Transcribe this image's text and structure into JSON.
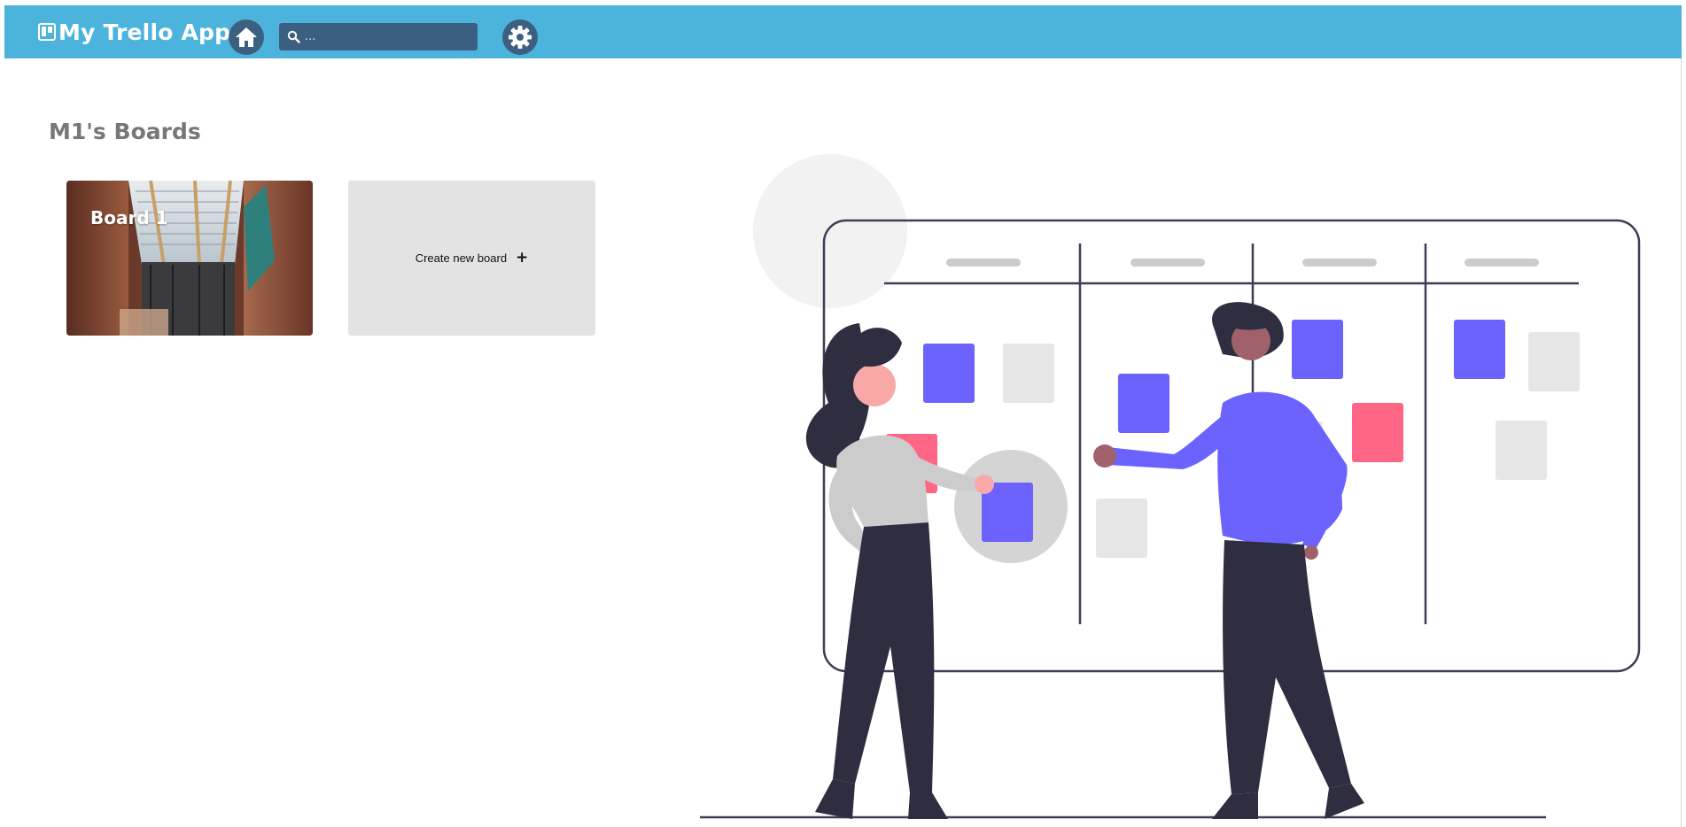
{
  "app": {
    "title": "My Trello App"
  },
  "navbar": {
    "home_icon": "home-icon",
    "search": {
      "placeholder": "...",
      "value": ""
    },
    "settings_icon": "gear-icon",
    "brand_icon": "board-icon"
  },
  "page": {
    "title": "M1's Boards"
  },
  "boards": [
    {
      "name": "Board 1"
    }
  ],
  "create_board": {
    "label": "Create new board",
    "icon": "+"
  },
  "colors": {
    "navbar": "#4cb3dc",
    "nav_button": "#3c6080",
    "card_accent": "#6c63ff",
    "card_pink": "#ff6584",
    "dark": "#2f2e41"
  }
}
